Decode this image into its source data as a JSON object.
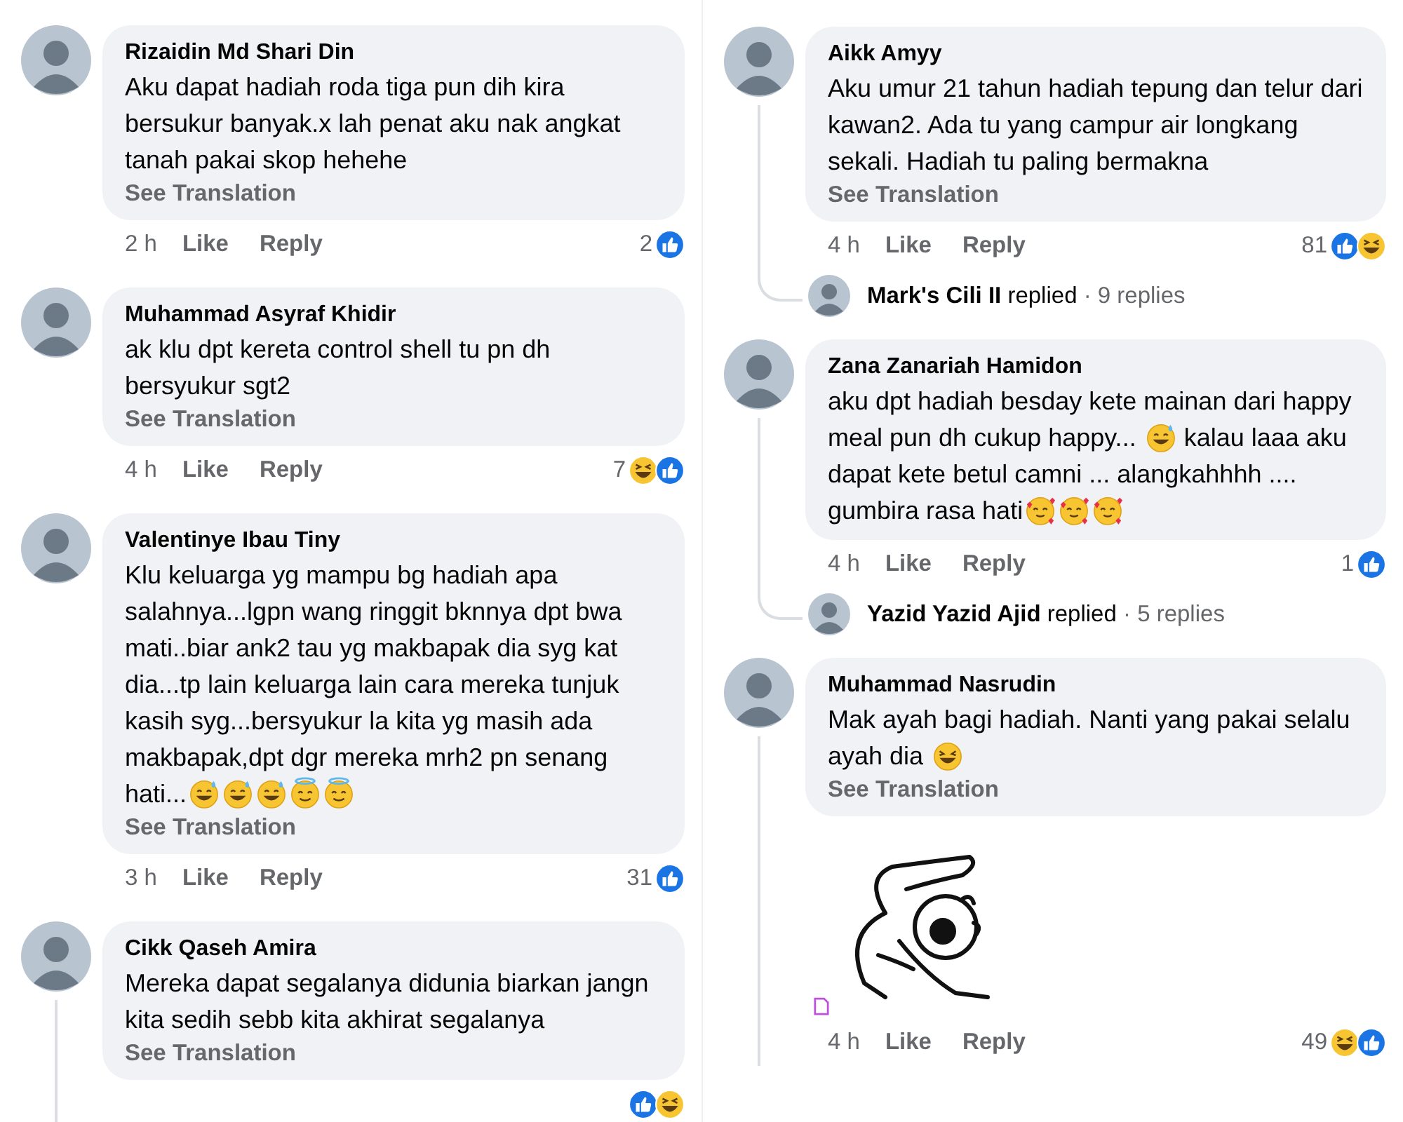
{
  "columns": [
    {
      "comments": [
        {
          "author": "Rizaidin Md Shari Din",
          "segments": [
            {
              "kind": "text",
              "text": "Aku dapat hadiah roda tiga pun dih kira bersukur banyak.x lah penat aku nak angkat tanah pakai skop  hehehe"
            }
          ],
          "see_translation": "See Translation",
          "time": "2 h",
          "like": "Like",
          "reply": "Reply",
          "reaction_count": "2",
          "reactions": [
            {
              "kind": "like"
            }
          ]
        },
        {
          "author": "Muhammad Asyraf Khidir",
          "segments": [
            {
              "kind": "text",
              "text": "ak klu dpt kereta control shell tu pn dh bersyukur sgt2"
            }
          ],
          "see_translation": "See Translation",
          "time": "4 h",
          "like": "Like",
          "reply": "Reply",
          "reaction_count": "7",
          "reactions": [
            {
              "kind": "haha"
            },
            {
              "kind": "like"
            }
          ]
        },
        {
          "author": "Valentinye Ibau Tiny",
          "segments": [
            {
              "kind": "text",
              "text": "Klu keluarga yg mampu bg hadiah apa salahnya...lgpn wang ringgit bknnya dpt bwa mati..biar ank2 tau yg makbapak dia syg kat dia...tp lain keluarga lain cara mereka tunjuk kasih syg...bersyukur la kita yg masih ada makbapak,dpt dgr mereka mrh2 pn senang hati..."
            },
            {
              "kind": "sweat"
            },
            {
              "kind": "sweat"
            },
            {
              "kind": "sweat"
            },
            {
              "kind": "halo"
            },
            {
              "kind": "halo"
            }
          ],
          "see_translation": "See Translation",
          "time": "3 h",
          "like": "Like",
          "reply": "Reply",
          "reaction_count": "31",
          "reactions": [
            {
              "kind": "like"
            }
          ]
        },
        {
          "author": "Cikk Qaseh Amira",
          "segments": [
            {
              "kind": "text",
              "text": "Mereka dapat segalanya didunia biarkan jangn kita sedih sebb kita akhirat segalanya"
            }
          ],
          "see_translation": "See Translation",
          "thread_line": true,
          "reactions": [
            {
              "kind": "like"
            },
            {
              "kind": "haha"
            }
          ]
        }
      ]
    },
    {
      "comments": [
        {
          "author": "Aikk Amyy",
          "segments": [
            {
              "kind": "text",
              "text": "Aku umur 21 tahun hadiah tepung dan telur dari kawan2. Ada tu yang campur air longkang sekali. Hadiah tu paling bermakna"
            }
          ],
          "see_translation": "See Translation",
          "time": "4 h",
          "like": "Like",
          "reply": "Reply",
          "reaction_count": "81",
          "reactions": [
            {
              "kind": "like"
            },
            {
              "kind": "haha"
            }
          ],
          "thread_line": true,
          "replies_summary": {
            "author": "Mark's Cili II",
            "verb": "replied",
            "count": "· 9 replies"
          }
        },
        {
          "author": "Zana Zanariah Hamidon",
          "segments": [
            {
              "kind": "text",
              "text": "aku dpt hadiah besday kete mainan dari happy meal pun dh cukup happy... "
            },
            {
              "kind": "sweat"
            },
            {
              "kind": "text",
              "text": " kalau laaa aku dapat kete betul camni ... alangkahhhh .... gumbira rasa hati"
            },
            {
              "kind": "hearts"
            },
            {
              "kind": "hearts"
            },
            {
              "kind": "hearts"
            }
          ],
          "time": "4 h",
          "like": "Like",
          "reply": "Reply",
          "reaction_count": "1",
          "reactions": [
            {
              "kind": "like"
            }
          ],
          "thread_line": true,
          "replies_summary": {
            "author": "Yazid Yazid Ajid",
            "verb": "replied",
            "count": "· 5 replies"
          }
        },
        {
          "author": "Muhammad Nasrudin",
          "segments": [
            {
              "kind": "text",
              "text": "Mak ayah bagi hadiah. Nanti yang pakai selalu ayah dia "
            },
            {
              "kind": "rofl"
            }
          ],
          "see_translation": "See Translation",
          "sticker": true,
          "time": "4 h",
          "like": "Like",
          "reply": "Reply",
          "reaction_count": "49",
          "reactions": [
            {
              "kind": "haha"
            },
            {
              "kind": "like"
            }
          ],
          "thread_line": true
        }
      ]
    }
  ]
}
